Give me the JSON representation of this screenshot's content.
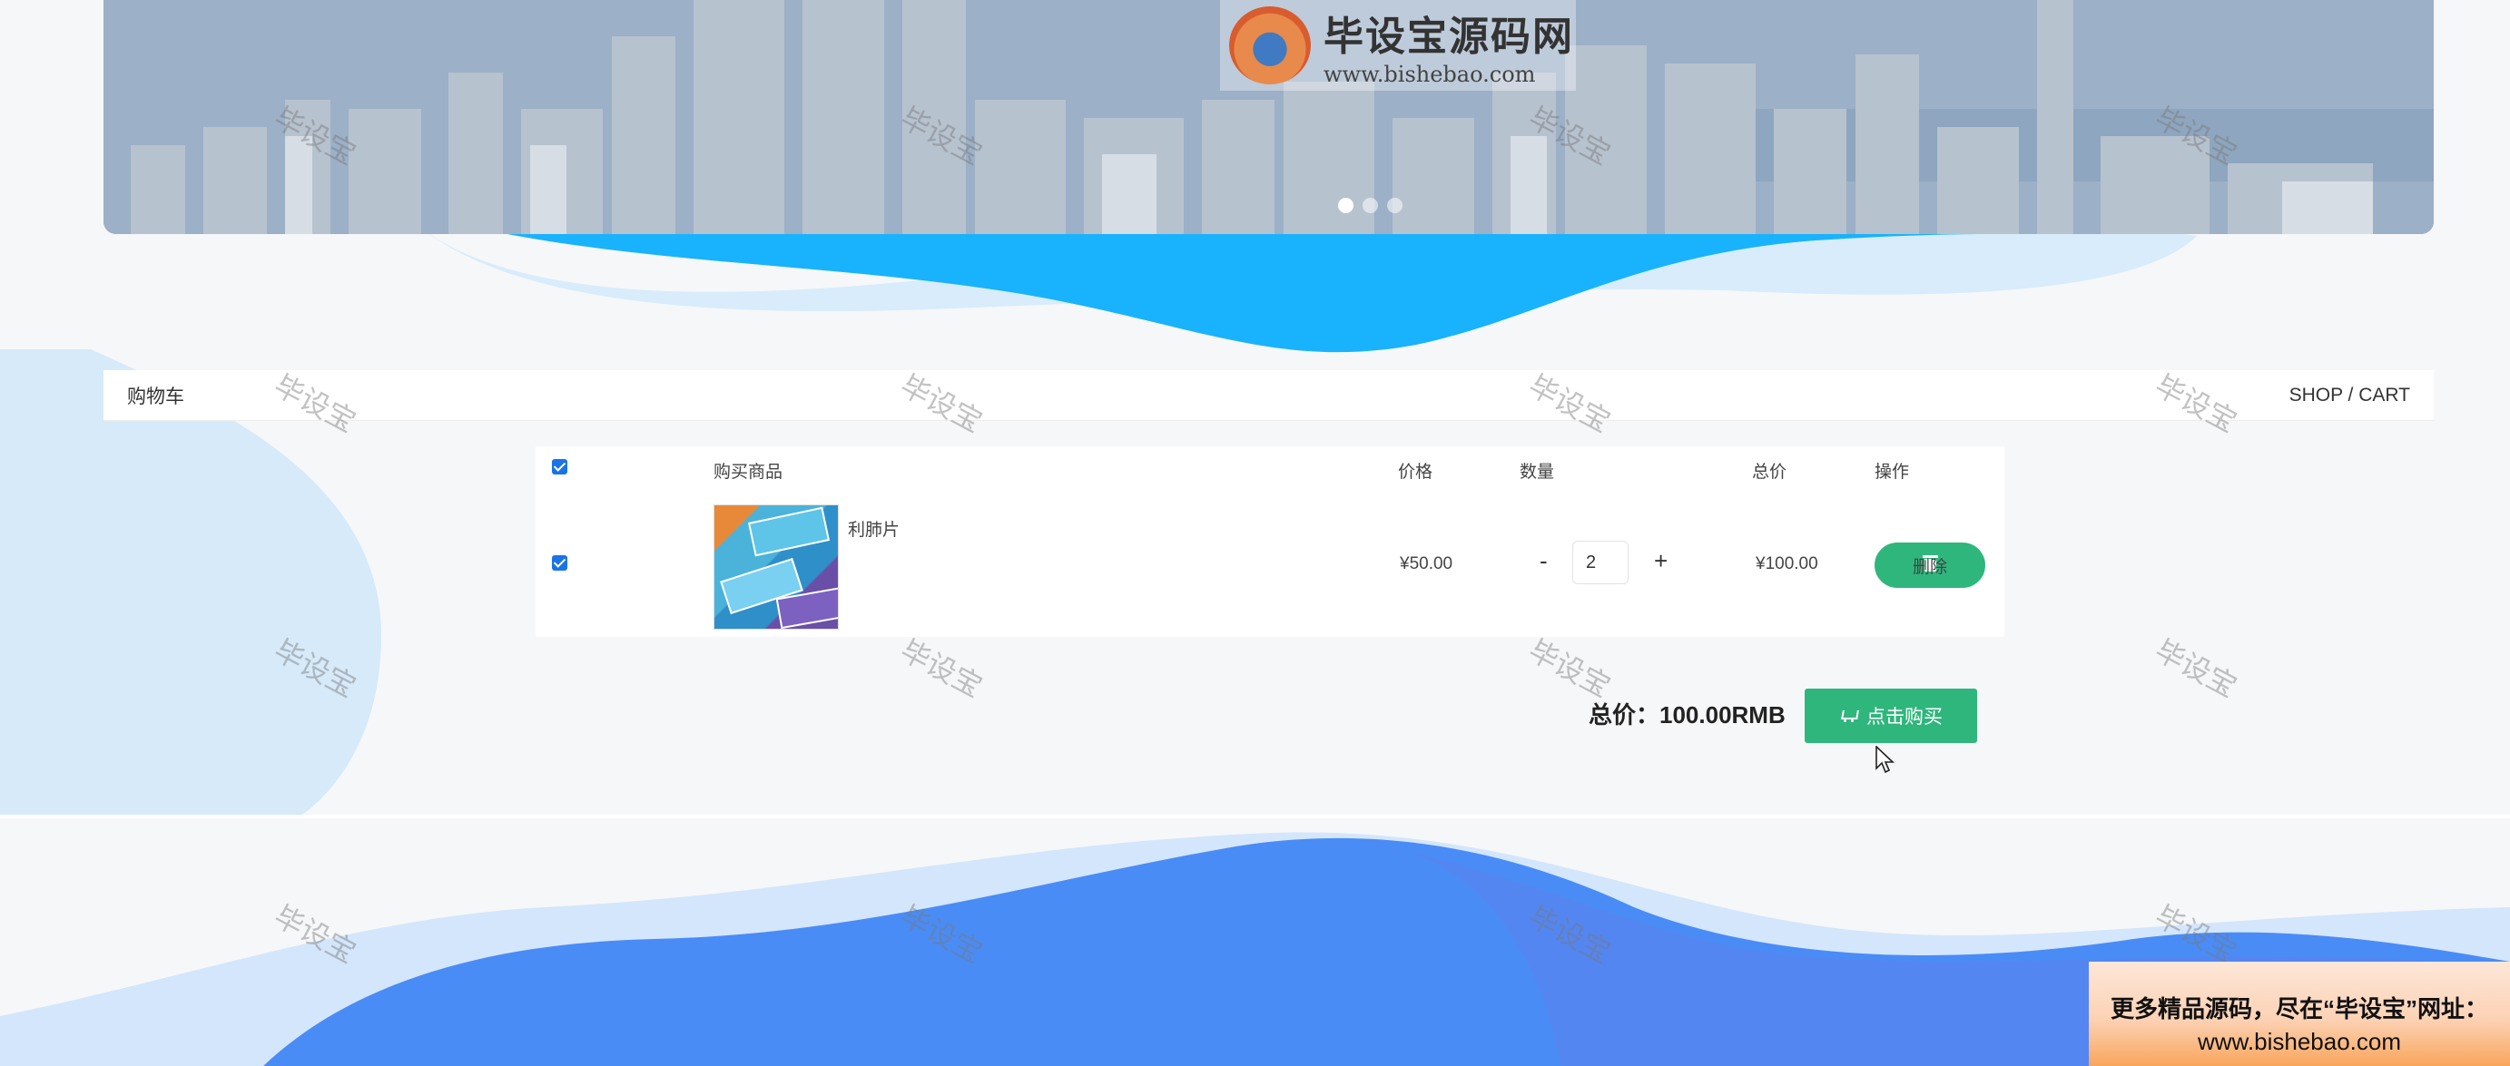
{
  "banner": {
    "logo_cn": "毕设宝源码网",
    "logo_en": "www.bishebao.com",
    "slides": 3,
    "active_slide": 1
  },
  "cart_bar": {
    "title": "购物车",
    "path": "SHOP / CART"
  },
  "cart_table": {
    "headers": {
      "product": "购买商品",
      "price": "价格",
      "quantity": "数量",
      "total": "总价",
      "action": "操作"
    },
    "rows": [
      {
        "name": "利肺片",
        "price": "¥50.00",
        "quantity": "2",
        "minus": "-",
        "plus": "+",
        "total": "¥100.00",
        "delete_label": "删除",
        "checked": true
      }
    ]
  },
  "summary": {
    "total_label": "总价：100.00RMB",
    "buy_label": "点击购买"
  },
  "watermark_text": "毕设宝",
  "promo": {
    "line1": "更多精品源码，尽在“毕设宝”网址：",
    "line2": "www.bishebao.com"
  },
  "colors": {
    "wave_top": "#17b2ff",
    "wave_bottom": "#4a8cf6",
    "accent_green": "#2fb67d"
  }
}
